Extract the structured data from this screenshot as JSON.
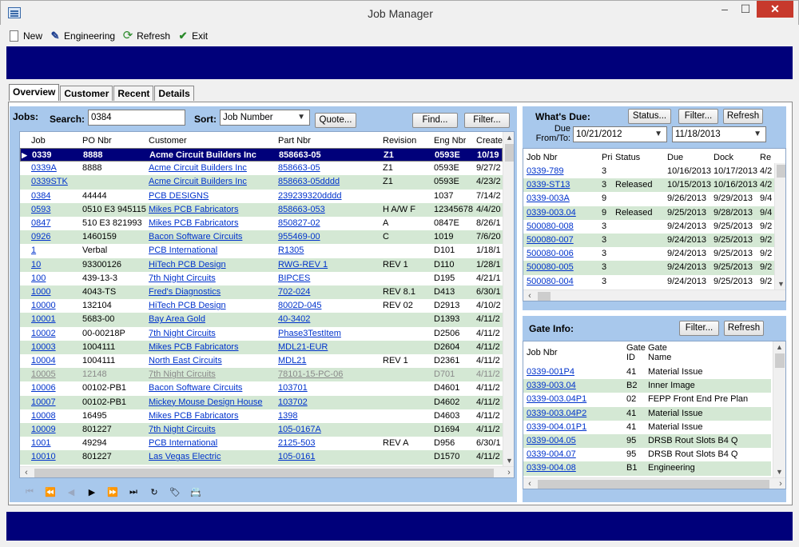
{
  "window": {
    "title": "Job Manager",
    "min": "‒",
    "max": "☐",
    "close": "✕"
  },
  "toolbar": {
    "new": "New",
    "engineering": "Engineering",
    "refresh": "Refresh",
    "exit": "Exit"
  },
  "tabs": [
    "Overview",
    "Customer",
    "Recent",
    "Details"
  ],
  "jobs": {
    "label": "Jobs:",
    "search_label": "Search:",
    "search_value": "0384",
    "sort_label": "Sort:",
    "sort_value": "Job Number",
    "quote": "Quote...",
    "find": "Find...",
    "filter": "Filter...",
    "columns": [
      "Job",
      "PO Nbr",
      "Customer",
      "Part Nbr",
      "Revision",
      "Eng Nbr",
      "Create"
    ],
    "rows": [
      [
        "0339",
        "8888",
        "Acme Circuit Builders Inc",
        "858663-05",
        "Z1",
        "0593E",
        "10/19"
      ],
      [
        "0339A",
        "8888",
        "Acme Circuit Builders Inc",
        "858663-05",
        "Z1",
        "0593E",
        "9/27/2"
      ],
      [
        "0339STK",
        "",
        "Acme Circuit Builders Inc",
        "858663-05dddd",
        "Z1",
        "0593E",
        "4/23/2"
      ],
      [
        "0384",
        "44444",
        "PCB DESIGNS",
        "239239320dddd",
        "",
        "1037",
        "7/14/2"
      ],
      [
        "0593",
        "0510 E3 945115",
        "Mikes PCB Fabricators",
        "858663-053",
        "H A/W F",
        "12345678",
        "4/4/20"
      ],
      [
        "0847",
        "510 E3 821993",
        "Mikes PCB Fabricators",
        "850827-02",
        "A",
        "0847E",
        "8/26/1"
      ],
      [
        "0926",
        "1460159",
        "Bacon Software Circuits",
        "955469-00",
        "C",
        "1019",
        "7/6/20"
      ],
      [
        "1",
        "Verbal",
        "PCB International",
        "R1305",
        "",
        "D101",
        "1/18/1"
      ],
      [
        "10",
        "93300126",
        "HiTech PCB Design",
        "RWG-REV 1",
        "REV 1",
        "D110",
        "1/28/1"
      ],
      [
        "100",
        "439-13-3",
        "7th Night Circuits",
        "BIPCES",
        "",
        "D195",
        "4/21/1"
      ],
      [
        "1000",
        "4043-TS",
        "Fred's Diagnostics",
        "702-024",
        "REV 8.1",
        "D413",
        "6/30/1"
      ],
      [
        "10000",
        "132104",
        "HiTech PCB Design",
        "8002D-045",
        "REV 02",
        "D2913",
        "4/10/2"
      ],
      [
        "10001",
        "5683-00",
        "Bay Area Gold",
        "40-3402",
        "",
        "D1393",
        "4/11/2"
      ],
      [
        "10002",
        "00-00218P",
        "7th Night Circuits",
        "Phase3TestItem",
        "",
        "D2506",
        "4/11/2"
      ],
      [
        "10003",
        "1004111",
        "Mikes PCB Fabricators",
        "MDL21-EUR",
        "",
        "D2604",
        "4/11/2"
      ],
      [
        "10004",
        "1004111",
        "North East Circuits",
        "MDL21",
        "REV 1",
        "D2361",
        "4/11/2"
      ],
      [
        "10005",
        "12148",
        "7th Night Circuits",
        "78101-15-PC-06",
        "",
        "D701",
        "4/11/2"
      ],
      [
        "10006",
        "00102-PB1",
        "Bacon Software Circuits",
        "103701",
        "",
        "D4601",
        "4/11/2"
      ],
      [
        "10007",
        "00102-PB1",
        "Mickey Mouse Design House",
        "103702",
        "",
        "D4602",
        "4/11/2"
      ],
      [
        "10008",
        "16495",
        "Mikes PCB Fabricators",
        "1398",
        "",
        "D4603",
        "4/11/2"
      ],
      [
        "10009",
        "801227",
        "7th Night Circuits",
        "105-0167A",
        "",
        "D1694",
        "4/11/2"
      ],
      [
        "1001",
        "49294",
        "PCB International",
        "2125-503",
        "REV A",
        "D956",
        "6/30/1"
      ],
      [
        "10010",
        "801227",
        "Las Vegas Electric",
        "105-0161",
        "",
        "D1570",
        "4/11/2"
      ]
    ]
  },
  "whats_due": {
    "label": "What's Due:",
    "status": "Status...",
    "filter": "Filter...",
    "refresh": "Refresh",
    "due_label": "Due From/To:",
    "from": "10/21/2012",
    "to": "11/18/2013",
    "columns": [
      "Job Nbr",
      "Pri",
      "Status",
      "Due",
      "Dock",
      "Re"
    ],
    "rows": [
      [
        "0339-789",
        "3",
        "",
        "10/16/2013",
        "10/17/2013",
        "4/2"
      ],
      [
        "0339-ST13",
        "3",
        "Released",
        "10/15/2013",
        "10/16/2013",
        "4/2"
      ],
      [
        "0339-003A",
        "9",
        "",
        "9/26/2013",
        "9/29/2013",
        "9/4"
      ],
      [
        "0339-003.04",
        "9",
        "Released",
        "9/25/2013",
        "9/28/2013",
        "9/4"
      ],
      [
        "500080-008",
        "3",
        "",
        "9/24/2013",
        "9/25/2013",
        "9/2"
      ],
      [
        "500080-007",
        "3",
        "",
        "9/24/2013",
        "9/25/2013",
        "9/2"
      ],
      [
        "500080-006",
        "3",
        "",
        "9/24/2013",
        "9/25/2013",
        "9/2"
      ],
      [
        "500080-005",
        "3",
        "",
        "9/24/2013",
        "9/25/2013",
        "9/2"
      ],
      [
        "500080-004",
        "3",
        "",
        "9/24/2013",
        "9/25/2013",
        "9/2"
      ]
    ]
  },
  "gate_info": {
    "label": "Gate Info:",
    "filter": "Filter...",
    "refresh": "Refresh",
    "col_job": "Job Nbr",
    "col_gate_id": "Gate ID",
    "col_gate_name": "Gate Name",
    "rows": [
      [
        "0339-001P4",
        "41",
        "Material Issue"
      ],
      [
        "0339-003.04",
        "B2",
        "Inner Image"
      ],
      [
        "0339-003.04P1",
        "02",
        "FEPP Front End Pre Plan"
      ],
      [
        "0339-003.04P2",
        "41",
        "Material Issue"
      ],
      [
        "0339-004.01P1",
        "41",
        "Material Issue"
      ],
      [
        "0339-004.05",
        "95",
        "DRSB Rout Slots B4 Q"
      ],
      [
        "0339-004.07",
        "95",
        "DRSB Rout Slots B4 Q"
      ],
      [
        "0339-004.08",
        "B1",
        "Engineering"
      ]
    ]
  },
  "navigator": [
    "⏮",
    "⏪",
    "◀",
    "▶",
    "⏩",
    "⏭",
    "↻",
    "🏷",
    "📇"
  ]
}
